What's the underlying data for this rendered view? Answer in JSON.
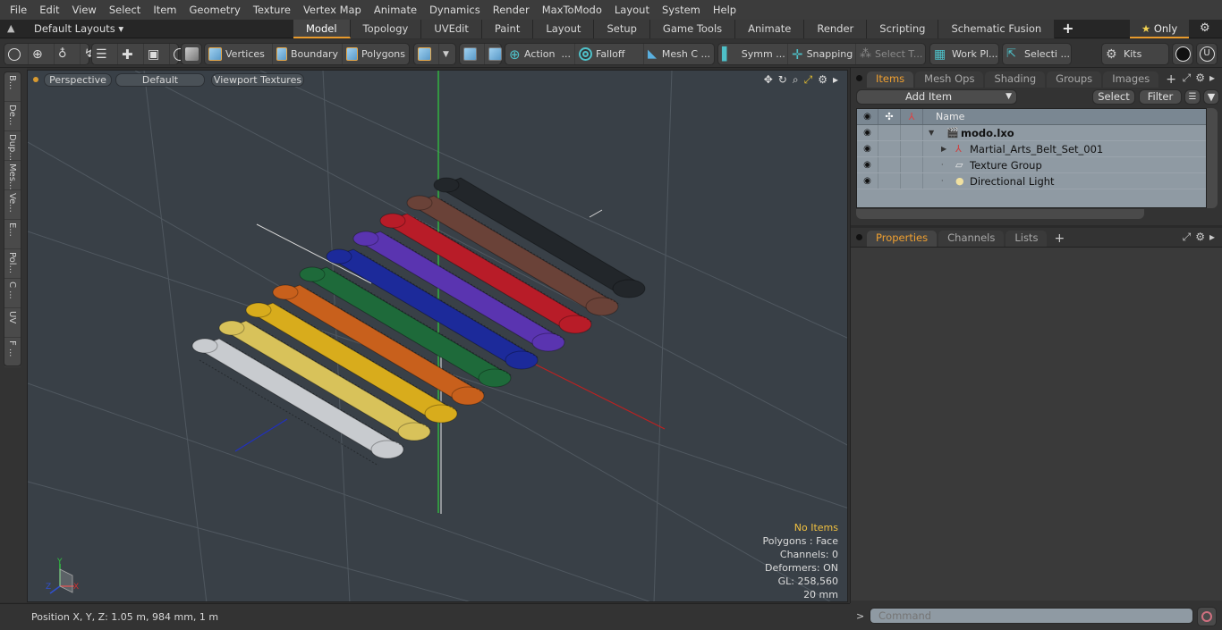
{
  "menubar": {
    "items": [
      "File",
      "Edit",
      "View",
      "Select",
      "Item",
      "Geometry",
      "Texture",
      "Vertex Map",
      "Animate",
      "Dynamics",
      "Render",
      "MaxToModo",
      "Layout",
      "System",
      "Help"
    ]
  },
  "layoutbar": {
    "layout_selector": "Default Layouts ▾",
    "tabs": [
      "Model",
      "Topology",
      "UVEdit",
      "Paint",
      "Layout",
      "Setup",
      "Game Tools",
      "Animate",
      "Render",
      "Scripting",
      "Schematic Fusion"
    ],
    "active_tab": "Model",
    "plus": "+",
    "only_label": "Only",
    "star": "★"
  },
  "toolbar": {
    "vertices": "Vertices",
    "boundary": "Boundary",
    "polygons": "Polygons",
    "action": "Action",
    "action_more": "...",
    "falloff": "Falloff",
    "mesh": "Mesh C ...",
    "symm": "Symm ...",
    "snapping": "Snapping",
    "select_t": "Select T...",
    "work_pl": "Work Pl...",
    "selecti": "Selecti ...",
    "kits": "Kits"
  },
  "left_tabs": [
    "B...",
    "De...",
    "Dup...",
    "Mes...",
    "Ve...",
    "E...",
    "Pol...",
    "C ...",
    "UV",
    "F ..."
  ],
  "viewport": {
    "view_mode": "Perspective",
    "shading": "Default",
    "textures": "Viewport Textures",
    "info": {
      "selection": "No Items",
      "polygons": "Polygons : Face",
      "channels": "Channels: 0",
      "deformers": "Deformers: ON",
      "gl": "GL: 258,560",
      "scale": "20 mm"
    },
    "belts": [
      {
        "name": "white",
        "color": "#c8cbcf"
      },
      {
        "name": "light-yellow",
        "color": "#d8c25a"
      },
      {
        "name": "yellow",
        "color": "#d8ac1c"
      },
      {
        "name": "orange",
        "color": "#c8601c"
      },
      {
        "name": "green",
        "color": "#1e6a3a"
      },
      {
        "name": "blue",
        "color": "#1c2a9a"
      },
      {
        "name": "purple",
        "color": "#5a34b0"
      },
      {
        "name": "red",
        "color": "#b81c28"
      },
      {
        "name": "brown",
        "color": "#6a4238"
      },
      {
        "name": "black",
        "color": "#22262a"
      }
    ],
    "axis": {
      "x": "X",
      "y": "Y",
      "z": "Z"
    }
  },
  "status": {
    "position": "Position X, Y, Z:   1.05 m, 984 mm, 1 m"
  },
  "items_panel": {
    "tabs": [
      "Items",
      "Mesh Ops",
      "Shading",
      "Groups",
      "Images"
    ],
    "active_tab": "Items",
    "plus": "+",
    "add_item": "Add Item",
    "select": "Select",
    "filter": "Filter",
    "column_name": "Name",
    "rows": [
      {
        "label": "modo.lxo",
        "icon": "🎬"
      },
      {
        "label": "Martial_Arts_Belt_Set_001",
        "icon": "⅄"
      },
      {
        "label": "Texture Group",
        "icon": "▱"
      },
      {
        "label": "Directional Light",
        "icon": "●"
      }
    ]
  },
  "properties_panel": {
    "tabs": [
      "Properties",
      "Channels",
      "Lists"
    ],
    "active_tab": "Properties",
    "plus": "+"
  },
  "command": {
    "prompt": ">",
    "placeholder": "Command"
  }
}
